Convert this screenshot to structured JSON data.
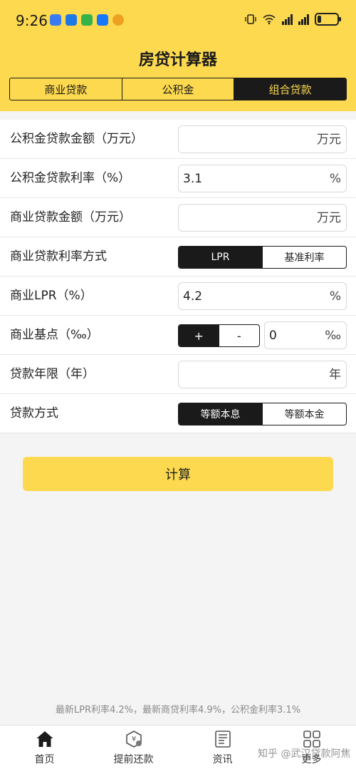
{
  "status_bar": {
    "time": "9:26"
  },
  "app_title": "房贷计算器",
  "loan_tabs": [
    "商业贷款",
    "公积金",
    "组合贷款"
  ],
  "form": {
    "provident_amount": {
      "label": "公积金贷款金额（万元）",
      "value": "",
      "unit": "万元"
    },
    "provident_rate": {
      "label": "公积金贷款利率（%）",
      "value": "3.1",
      "unit": "%"
    },
    "commercial_amount": {
      "label": "商业贷款金额（万元）",
      "value": "",
      "unit": "万元"
    },
    "rate_mode": {
      "label": "商业贷款利率方式",
      "options": [
        "LPR",
        "基准利率"
      ]
    },
    "lpr": {
      "label": "商业LPR（%）",
      "value": "4.2",
      "unit": "%"
    },
    "basis_points": {
      "label": "商业基点（‰）",
      "plus": "+",
      "minus": "-",
      "value": "0",
      "unit": "‰"
    },
    "term": {
      "label": "贷款年限（年）",
      "value": "",
      "unit": "年"
    },
    "repayment": {
      "label": "贷款方式",
      "options": [
        "等额本息",
        "等额本金"
      ]
    }
  },
  "calculate_label": "计算",
  "footer_note": "最新LPR利率4.2%，最新商贷利率4.9%，公积金利率3.1%",
  "tabbar": [
    "首页",
    "提前还款",
    "资讯",
    "更多"
  ],
  "watermark": "知乎 @武汉贷款阿焦",
  "colors": {
    "accent": "#fcd94e",
    "dark": "#1a1a1a"
  }
}
